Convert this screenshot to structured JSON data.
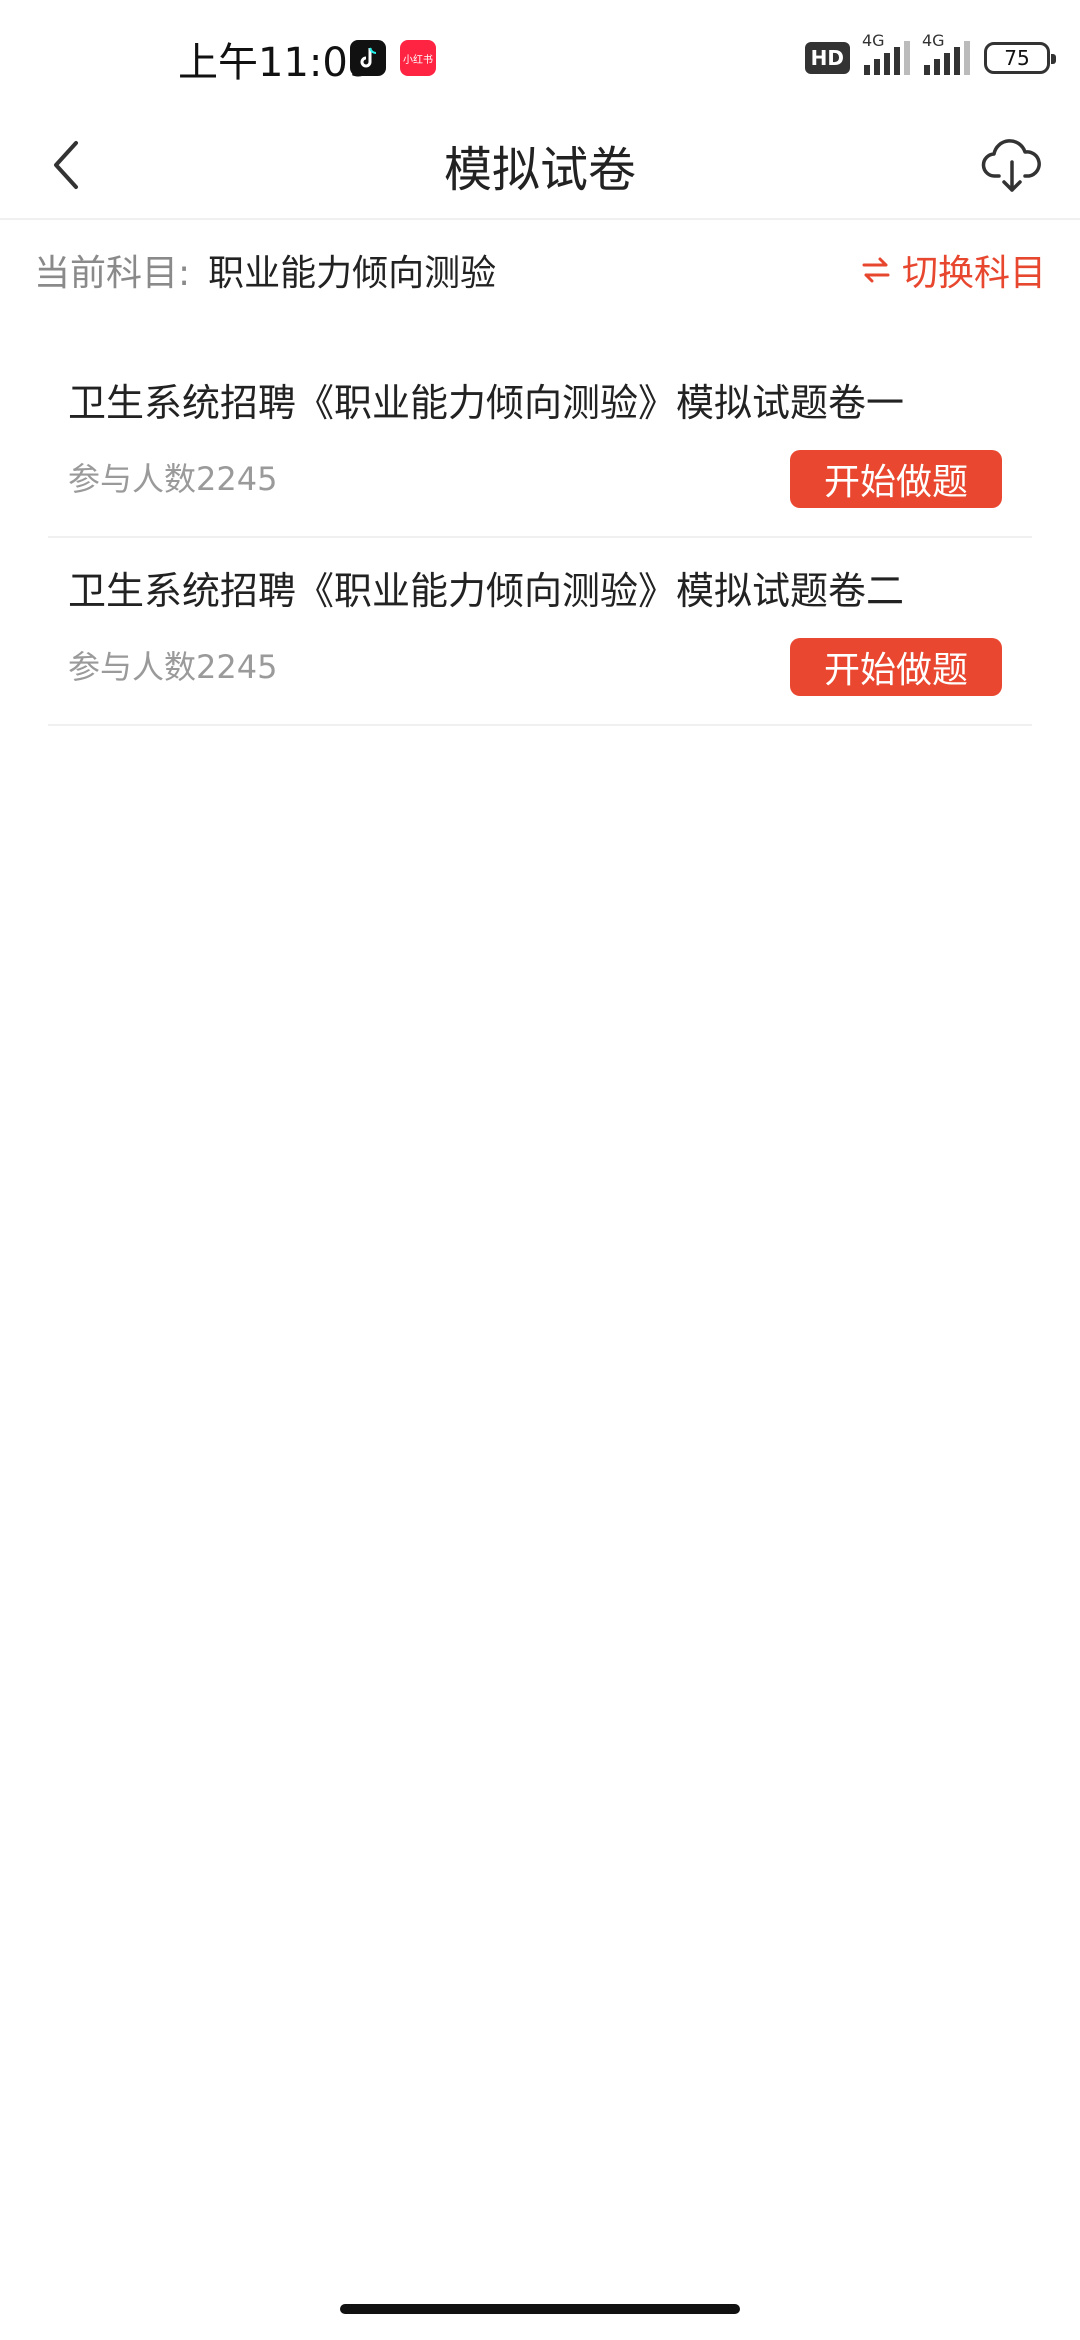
{
  "status_bar": {
    "time": "上午11:09",
    "hd_label": "HD",
    "network_1": "4G",
    "network_2": "4G",
    "battery": "75",
    "xhs_label": "小红书"
  },
  "header": {
    "title": "模拟试卷",
    "back_icon": "chevron-left-icon",
    "download_icon": "cloud-download-icon"
  },
  "subject": {
    "label": "当前科目:",
    "value": "职业能力倾向测验",
    "switch_label": "切换科目",
    "switch_icon": "swap-arrows-icon"
  },
  "papers": [
    {
      "title": "卫生系统招聘《职业能力倾向测验》模拟试题卷一",
      "participants": "参与人数2245",
      "button": "开始做题"
    },
    {
      "title": "卫生系统招聘《职业能力倾向测验》模拟试题卷二",
      "participants": "参与人数2245",
      "button": "开始做题"
    }
  ],
  "colors": {
    "accent": "#e9472f",
    "muted_text": "#9a9a9a"
  }
}
